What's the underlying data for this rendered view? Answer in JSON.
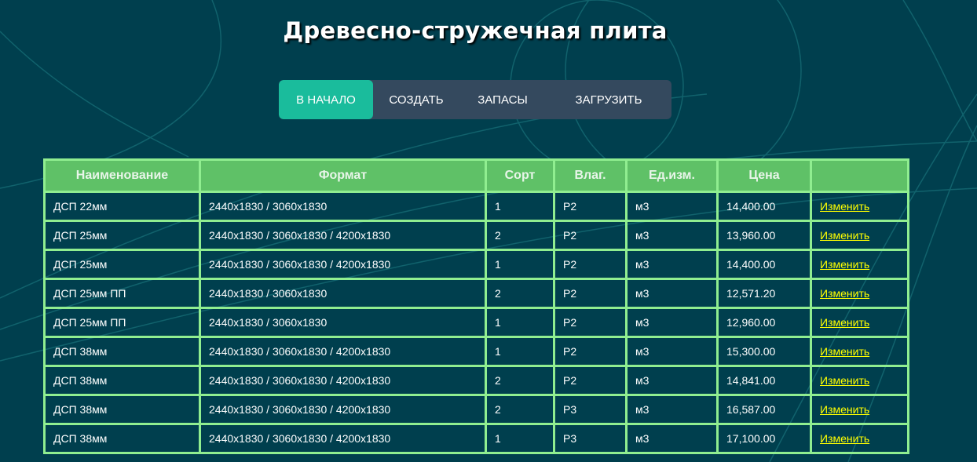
{
  "page": {
    "title": "Древесно-стружечная плита"
  },
  "nav": {
    "items": [
      {
        "label": "В НАЧАЛО",
        "active": true
      },
      {
        "label": "СОЗДАТЬ",
        "active": false
      },
      {
        "label": "ЗАПАСЫ",
        "active": false
      },
      {
        "label": "ЗАГРУЗИТЬ",
        "active": false
      }
    ]
  },
  "table": {
    "headers": [
      "Наименование",
      "Формат",
      "Сорт",
      "Влаг.",
      "Ед.изм.",
      "Цена",
      ""
    ],
    "rows": [
      {
        "name": "ДСП 22мм",
        "format": "2440x1830 / 3060x1830",
        "sort": "1",
        "moisture": "P2",
        "unit": "м3",
        "price": "14,400.00",
        "action": "Изменить"
      },
      {
        "name": "ДСП 25мм",
        "format": "2440x1830 / 3060x1830 / 4200x1830",
        "sort": "2",
        "moisture": "P2",
        "unit": "м3",
        "price": "13,960.00",
        "action": "Изменить"
      },
      {
        "name": "ДСП 25мм",
        "format": "2440x1830 / 3060x1830 / 4200x1830",
        "sort": "1",
        "moisture": "P2",
        "unit": "м3",
        "price": "14,400.00",
        "action": "Изменить"
      },
      {
        "name": "ДСП 25мм ПП",
        "format": "2440x1830 / 3060x1830",
        "sort": "2",
        "moisture": "P2",
        "unit": "м3",
        "price": "12,571.20",
        "action": "Изменить"
      },
      {
        "name": "ДСП 25мм ПП",
        "format": "2440x1830 / 3060x1830",
        "sort": "1",
        "moisture": "P2",
        "unit": "м3",
        "price": "12,960.00",
        "action": "Изменить"
      },
      {
        "name": "ДСП 38мм",
        "format": "2440x1830 / 3060x1830 / 4200x1830",
        "sort": "1",
        "moisture": "P2",
        "unit": "м3",
        "price": "15,300.00",
        "action": "Изменить"
      },
      {
        "name": "ДСП 38мм",
        "format": "2440x1830 / 3060x1830 / 4200x1830",
        "sort": "2",
        "moisture": "P2",
        "unit": "м3",
        "price": "14,841.00",
        "action": "Изменить"
      },
      {
        "name": "ДСП 38мм",
        "format": "2440x1830 / 3060x1830 / 4200x1830",
        "sort": "2",
        "moisture": "P3",
        "unit": "м3",
        "price": "16,587.00",
        "action": "Изменить"
      },
      {
        "name": "ДСП 38мм",
        "format": "2440x1830 / 3060x1830 / 4200x1830",
        "sort": "1",
        "moisture": "P3",
        "unit": "м3",
        "price": "17,100.00",
        "action": "Изменить"
      }
    ]
  },
  "colors": {
    "background": "#003f4e",
    "header_bg": "#5fc167",
    "border": "#90ee90",
    "nav_bg": "#34495e",
    "nav_active": "#1abc9c",
    "link": "#ffff00"
  }
}
